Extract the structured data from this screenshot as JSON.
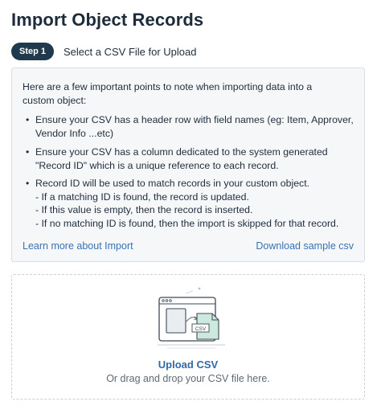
{
  "page": {
    "title": "Import Object Records"
  },
  "step": {
    "badge": "Step 1",
    "label": "Select a CSV File for Upload"
  },
  "info": {
    "intro": "Here are a few important points to note when importing data into a custom object:",
    "bullets": [
      {
        "lines": [
          "Ensure your CSV has a header row with field names (eg: Item, Approver,",
          "Vendor Info ...etc)"
        ]
      },
      {
        "lines": [
          "Ensure your CSV has a column dedicated to the system generated",
          "\"Record ID\" which is a unique reference to each record."
        ]
      },
      {
        "lines": [
          "Record ID will be used to match records in your custom object.",
          "- If a matching ID is found, the record is updated.",
          "- If this value is empty, then the record is inserted.",
          "- If no matching ID is found, then the import is skipped for that record."
        ]
      }
    ],
    "learn_more": "Learn more about Import",
    "download_sample": "Download sample csv"
  },
  "upload": {
    "file_tag": "CSV",
    "button_label": "Upload CSV",
    "hint": "Or drag and drop your CSV file here."
  },
  "colors": {
    "accent_link": "#3a72b0",
    "badge_bg": "#1f3a4d",
    "illustration_green": "#cde8dd"
  }
}
